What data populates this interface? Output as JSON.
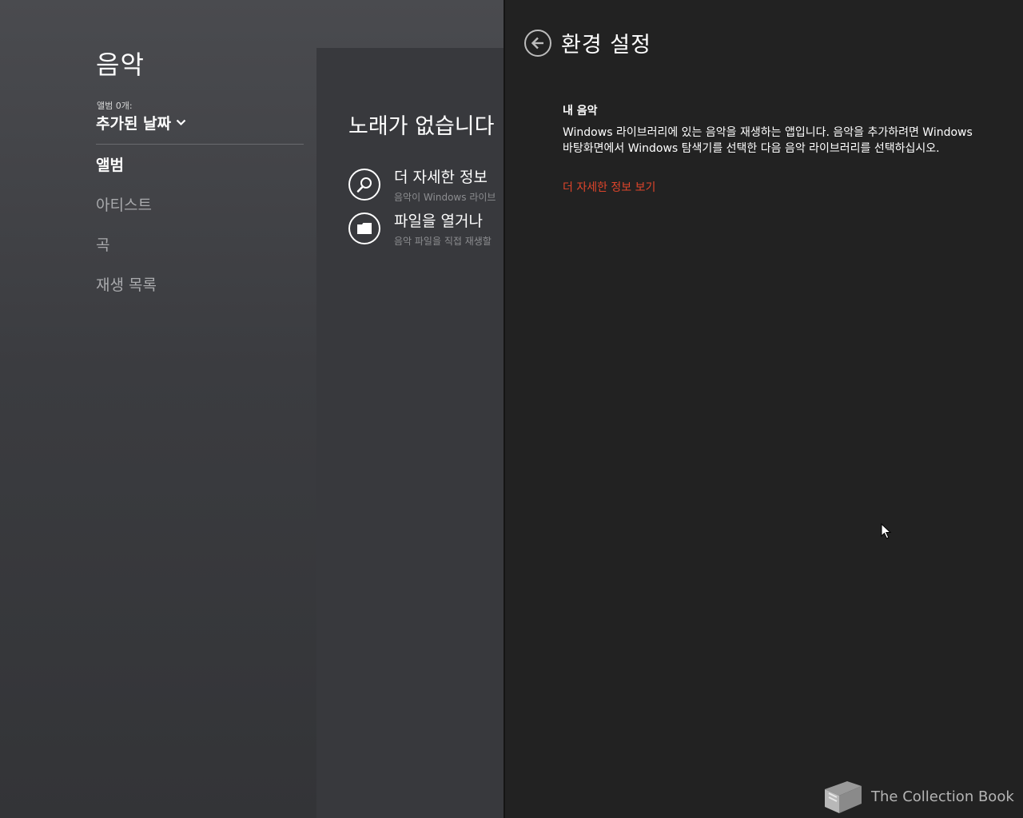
{
  "app": {
    "title": "음악",
    "album_count": "앨범 0개:",
    "sort_label": "추가된 날짜",
    "nav": [
      {
        "label": "앨범",
        "active": true
      },
      {
        "label": "아티스트",
        "active": false
      },
      {
        "label": "곡",
        "active": false
      },
      {
        "label": "재생 목록",
        "active": false
      }
    ],
    "empty_state": {
      "title": "노래가 없습니다",
      "actions": [
        {
          "title": "더 자세한 정보",
          "subtitle": "음악이 Windows 라이브",
          "icon": "search-icon"
        },
        {
          "title": "파일을 열거나 ",
          "subtitle": "음악 파일을 직접 재생할",
          "icon": "folder-icon"
        }
      ]
    }
  },
  "settings": {
    "title": "환경 설정",
    "back_icon": "back-arrow-icon",
    "section_heading": "내 음악",
    "section_body": "Windows 라이브러리에 있는 음악을 재생하는 앱입니다. 음악을 추가하려면 Windows 바탕화면에서 Windows 탐색기를 선택한 다음 음악 라이브러리를 선택하십시오.",
    "learn_more_link": "더 자세한 정보 보기",
    "link_color": "#e0452b"
  },
  "watermark": {
    "text": "The Collection Book",
    "icon": "book-icon"
  },
  "colors": {
    "flyout_bg": "#222222",
    "app_bg": "#3b3c40",
    "accent": "#e0452b"
  }
}
